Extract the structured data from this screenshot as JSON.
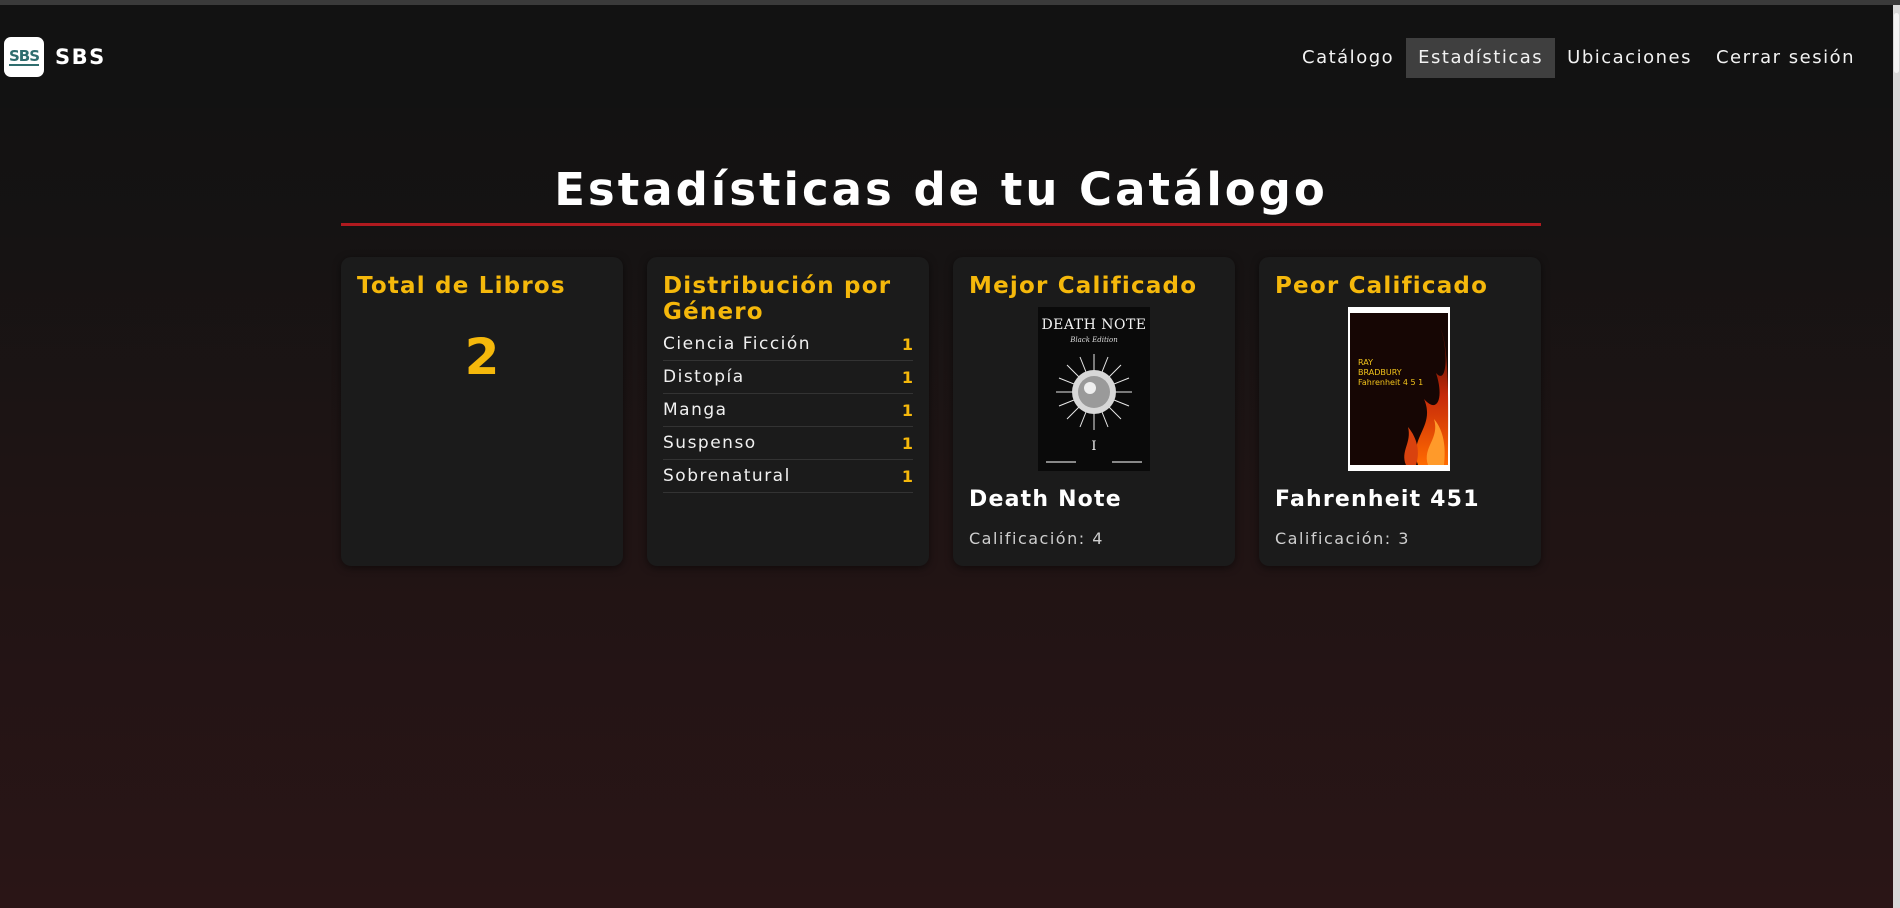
{
  "brand": {
    "logo_text": "SBS",
    "name": "SBS"
  },
  "nav": {
    "items": [
      {
        "label": "Catálogo"
      },
      {
        "label": "Estadísticas"
      },
      {
        "label": "Ubicaciones"
      },
      {
        "label": "Cerrar sesión"
      }
    ],
    "active": "Estadísticas"
  },
  "page": {
    "title": "Estadísticas de tu Catálogo"
  },
  "cards": {
    "total": {
      "title": "Total de Libros",
      "value": "2"
    },
    "genres": {
      "title": "Distribución por Género",
      "items": [
        {
          "name": "Ciencia Ficción",
          "count": "1"
        },
        {
          "name": "Distopía",
          "count": "1"
        },
        {
          "name": "Manga",
          "count": "1"
        },
        {
          "name": "Suspenso",
          "count": "1"
        },
        {
          "name": "Sobrenatural",
          "count": "1"
        }
      ]
    },
    "best": {
      "title": "Mejor Calificado",
      "book": "Death Note",
      "rating": "Calificación: 4",
      "cover": {
        "title_text": "DEATH NOTE",
        "subtitle": "Black Edition",
        "volume": "I"
      }
    },
    "worst": {
      "title": "Peor Calificado",
      "book": "Fahrenheit 451",
      "rating": "Calificación: 3",
      "cover": {
        "author_line1": "RAY",
        "author_line2": "BRADBURY",
        "title_text": "Fahrenheit 4 5 1"
      }
    }
  },
  "colors": {
    "accent": "#f5b80b",
    "rule": "#b01a1f",
    "card_bg": "#1b1b1b",
    "active_nav": "#3f3f3f"
  }
}
